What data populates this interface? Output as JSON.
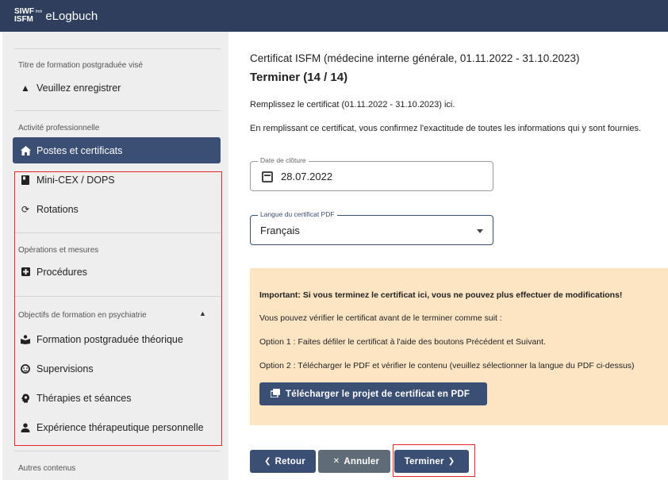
{
  "topbar": {
    "logo_line1": "SIWF",
    "logo_fmh": "fmh",
    "logo_line2": "ISFM",
    "app_title": "eLogbuch"
  },
  "sidebar": {
    "section_goal": "Titre de formation postgraduée visé",
    "goal_item": "Veuillez enregistrer",
    "section_activity": "Activité professionnelle",
    "items_activity": [
      {
        "label": "Postes et certificats",
        "icon": "home-icon"
      },
      {
        "label": "Mini-CEX / DOPS",
        "icon": "book-icon"
      },
      {
        "label": "Rotations",
        "icon": "rotate-icon"
      }
    ],
    "section_ops": "Opérations et mesures",
    "item_procedures": "Procédures",
    "section_psy": "Objectifs de formation en psychiatrie",
    "items_psy": [
      {
        "label": "Formation postgraduée théorique",
        "icon": "reading-icon"
      },
      {
        "label": "Supervisions",
        "icon": "face-icon"
      },
      {
        "label": "Thérapies et séances",
        "icon": "psychology-icon"
      },
      {
        "label": "Expérience thérapeutique personnelle",
        "icon": "person-icon"
      }
    ],
    "section_other": "Autres contenus"
  },
  "main": {
    "cert_title": "Certificat ISFM (médecine interne générale, 01.11.2022 - 31.10.2023)",
    "step_title": "Terminer (14 / 14)",
    "para1": "Remplissez le certificat (01.11.2022 - 31.10.2023) ici.",
    "para2": "En remplissant ce certificat, vous confirmez l'exactitude de toutes les informations qui y sont fournies.",
    "date_field": {
      "label": "Date de clôture",
      "value": "28.07.2022"
    },
    "lang_field": {
      "label": "Langue du certificat PDF",
      "value": "Français"
    },
    "notice": {
      "important": "Important: Si vous terminez le certificat ici, vous ne pouvez plus effectuer de modifications!",
      "line2": "Vous pouvez vérifier le certificat avant de le terminer comme suit :",
      "line3": "Option 1 : Faites défiler le certificat à l'aide des boutons Précédent et Suivant.",
      "line4": "Option 2 : Télécharger le PDF et vérifier le contenu (veuillez sélectionner la langue du PDF ci-dessus)",
      "download_label": "Télécharger le projet de certificat en PDF"
    },
    "buttons": {
      "back": "Retour",
      "cancel": "Annuler",
      "finish": "Terminer"
    }
  },
  "colors": {
    "topbar": "#2e3e5c",
    "primary": "#3b4e74",
    "notice_bg": "#fde5c4",
    "highlight_border": "#e0262b"
  }
}
